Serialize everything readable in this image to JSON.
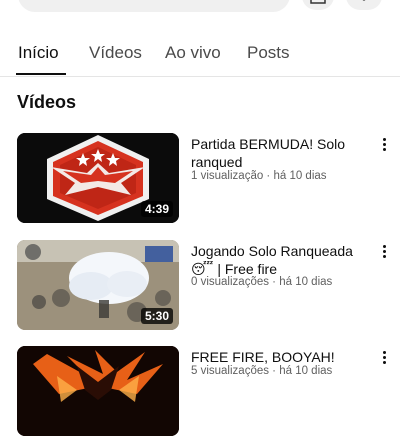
{
  "header": {
    "search_ghost_text": "",
    "icons": [
      "search-icon",
      "cast-icon",
      "more-icon"
    ]
  },
  "tabs": [
    {
      "label": "Início",
      "active": true
    },
    {
      "label": "Vídeos",
      "active": false
    },
    {
      "label": "Ao vivo",
      "active": false
    },
    {
      "label": "Posts",
      "active": false
    }
  ],
  "section": {
    "title": "Vídeos"
  },
  "videos": [
    {
      "title": "Partida BERMUDA! Solo ranqued",
      "meta": "1 visualização · há 10 dias",
      "duration": "4:39",
      "thumb_colors": {
        "badge": "#d6321f",
        "bg": "#0b0b0b",
        "rim": "#f0f0f0"
      }
    },
    {
      "title": "Jogando Solo Ranqueada 😴 | Free fire",
      "meta": "0 visualizações · há 10 dias",
      "duration": "5:30",
      "thumb_colors": {
        "ground": "#a59a85",
        "smoke": "#f4f7fb",
        "accent": "#2b4f9a"
      }
    },
    {
      "title": "FREE FIRE, BOOYAH!",
      "meta": "5 visualizações · há 10 dias",
      "duration": "",
      "thumb_colors": {
        "fire": "#ff6a1a",
        "bg": "#120603"
      }
    }
  ],
  "colors": {
    "text_primary": "#0f0f0f",
    "text_secondary": "#606060",
    "divider": "#e5e5e5"
  }
}
